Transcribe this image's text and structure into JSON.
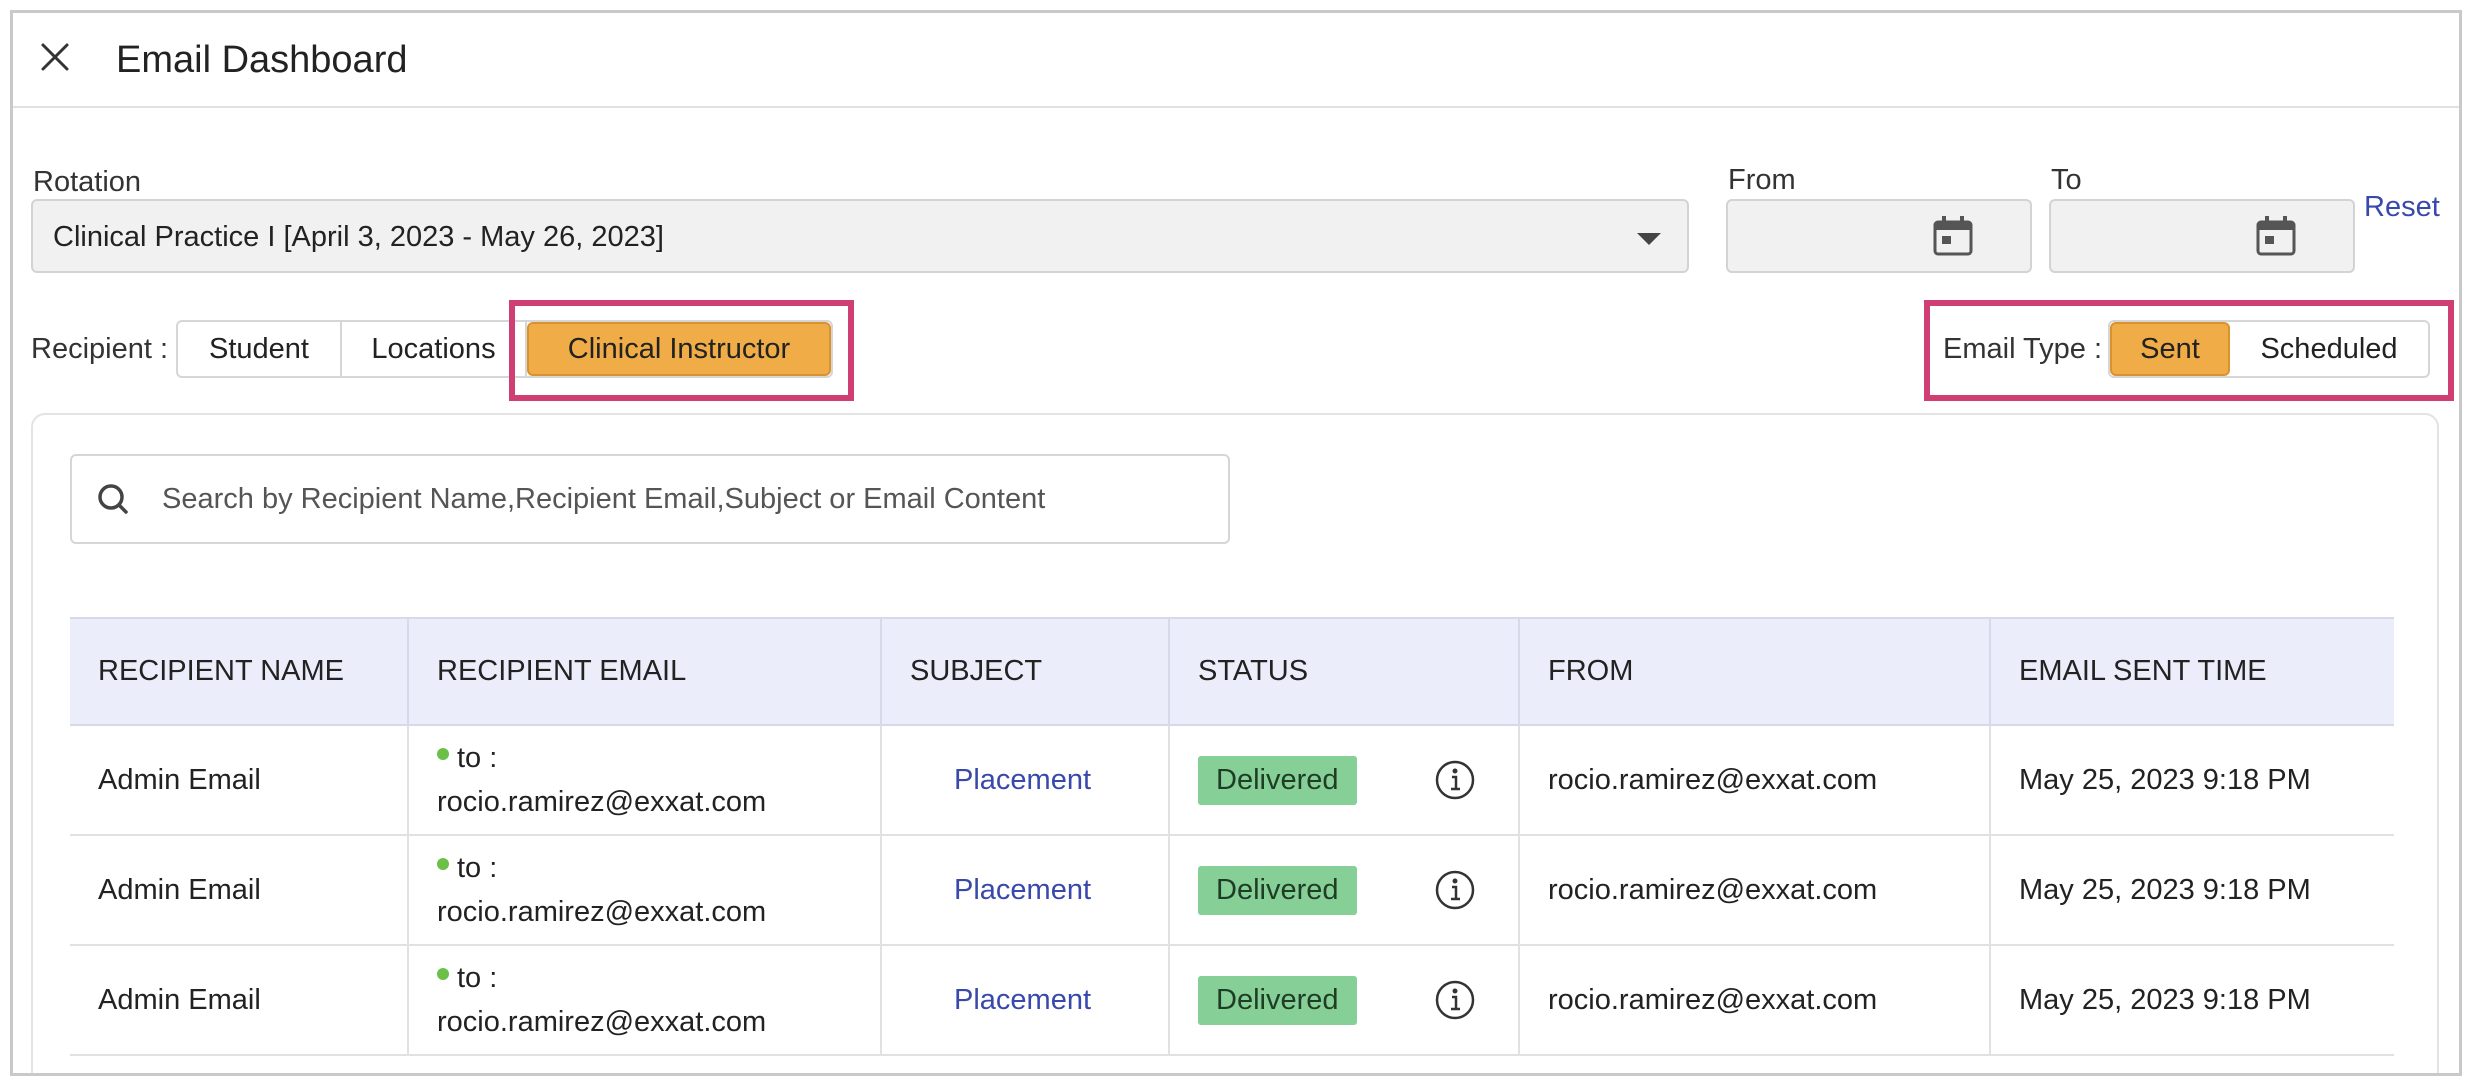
{
  "header": {
    "title": "Email Dashboard"
  },
  "filters": {
    "rotation_label": "Rotation",
    "rotation_value": "Clinical Practice I [April 3, 2023 - May 26, 2023]",
    "from_label": "From",
    "to_label": "To",
    "reset_label": "Reset"
  },
  "recipient": {
    "label": "Recipient :",
    "options": [
      "Student",
      "Locations",
      "Clinical Instructor"
    ],
    "selected": "Clinical Instructor"
  },
  "email_type": {
    "label": "Email Type :",
    "options": [
      "Sent",
      "Scheduled"
    ],
    "selected": "Sent"
  },
  "search": {
    "placeholder": "Search by Recipient Name,Recipient Email,Subject or Email Content"
  },
  "table": {
    "columns": [
      "RECIPIENT NAME",
      "RECIPIENT EMAIL",
      "SUBJECT",
      "STATUS",
      "FROM",
      "EMAIL SENT TIME"
    ],
    "rows": [
      {
        "name": "Admin Email",
        "to_prefix": "to :",
        "email": "rocio.ramirez@exxat.com",
        "subject": "Placement",
        "status": "Delivered",
        "from": "rocio.ramirez@exxat.com",
        "sent_time": "May 25, 2023 9:18 PM"
      },
      {
        "name": "Admin Email",
        "to_prefix": "to :",
        "email": "rocio.ramirez@exxat.com",
        "subject": "Placement",
        "status": "Delivered",
        "from": "rocio.ramirez@exxat.com",
        "sent_time": "May 25, 2023 9:18 PM"
      },
      {
        "name": "Admin Email",
        "to_prefix": "to :",
        "email": "rocio.ramirez@exxat.com",
        "subject": "Placement",
        "status": "Delivered",
        "from": "rocio.ramirez@exxat.com",
        "sent_time": "May 25, 2023 9:18 PM"
      }
    ]
  },
  "colors": {
    "accent": "#f0ad47",
    "highlight": "#cf3f73",
    "link": "#3949ab",
    "status_delivered": "#86cf97",
    "table_header": "#ecedfb"
  },
  "icons": {
    "close": "close-icon",
    "calendar": "calendar-icon",
    "dropdown": "chevron-down-icon",
    "search": "search-icon",
    "info": "info-icon"
  }
}
